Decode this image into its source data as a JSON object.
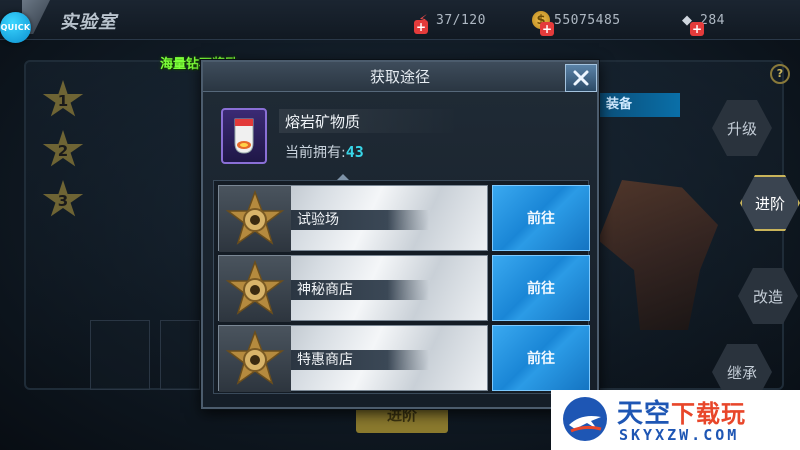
{
  "header": {
    "quick_label": "QUICK",
    "title": "实验室",
    "energy": "37/120",
    "coins": "55075485",
    "diamonds": "284"
  },
  "banner": "海量钻石奖励",
  "background": {
    "slots": [
      "1",
      "2",
      "3"
    ],
    "equip_tag": "装备",
    "side_buttons": [
      "升级",
      "进阶",
      "改造",
      "继承"
    ],
    "active_side_button": "进阶",
    "advance_button": "进阶",
    "help": "?"
  },
  "modal": {
    "title": "获取途径",
    "item_name": "熔岩矿物质",
    "owned_label": "当前拥有:",
    "owned_value": "43",
    "sources": [
      {
        "name": "试验场",
        "action": "前往"
      },
      {
        "name": "神秘商店",
        "action": "前往"
      },
      {
        "name": "特惠商店",
        "action": "前往"
      }
    ]
  },
  "watermark": {
    "cn_main": "天空",
    "cn_sub": "下载玩",
    "en": "SKYXZW.COM"
  },
  "colors": {
    "accent_blue": "#1a86d6",
    "owned_count": "#38d6e8",
    "banner_green": "#7dff3a",
    "item_purple": "#8a6fd6"
  }
}
